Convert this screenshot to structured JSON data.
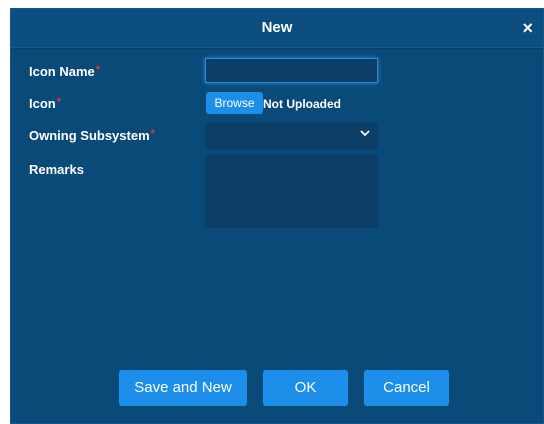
{
  "dialog": {
    "title": "New",
    "close_icon": "×"
  },
  "form": {
    "icon_name": {
      "label": "Icon Name",
      "required_mark": "*",
      "value": ""
    },
    "icon": {
      "label": "Icon",
      "required_mark": "*",
      "browse_label": "Browse",
      "status": "Not Uploaded"
    },
    "owning_subsystem": {
      "label": "Owning Subsystem",
      "required_mark": "*",
      "selected": ""
    },
    "remarks": {
      "label": "Remarks",
      "value": ""
    }
  },
  "buttons": {
    "save_and_new": "Save and New",
    "ok": "OK",
    "cancel": "Cancel"
  },
  "colors": {
    "background": "#0a4a79",
    "accent": "#1d8eea",
    "required": "#e0383c"
  }
}
